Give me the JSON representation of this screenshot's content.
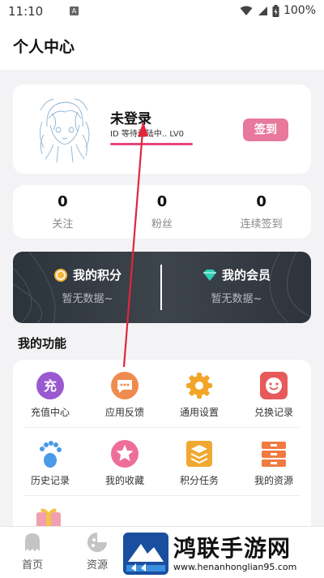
{
  "status_bar": {
    "time": "11:10",
    "notification_icon": "A",
    "battery": "100%"
  },
  "header": {
    "title": "个人中心"
  },
  "profile": {
    "username": "未登录",
    "id_text": "ID 等待登陆中..   LV0",
    "checkin_label": "签到"
  },
  "stats": [
    {
      "value": "0",
      "label": "关注"
    },
    {
      "value": "0",
      "label": "粉丝"
    },
    {
      "value": "0",
      "label": "连续签到"
    }
  ],
  "vip": {
    "points_title": "我的积分",
    "points_sub": "暂无数据~",
    "member_title": "我的会员",
    "member_sub": "暂无数据~"
  },
  "section": {
    "title": "我的功能"
  },
  "functions": [
    {
      "label": "充值中心",
      "icon": "recharge-icon",
      "icon_text": "充",
      "color": "#9b59d0"
    },
    {
      "label": "应用反馈",
      "icon": "feedback-icon",
      "color": "#ef8b4f"
    },
    {
      "label": "通用设置",
      "icon": "settings-icon",
      "color": "#f2a527"
    },
    {
      "label": "兑换记录",
      "icon": "exchange-icon",
      "color": "#e85a5a"
    },
    {
      "label": "历史记录",
      "icon": "history-icon",
      "color": "#4a9ae8"
    },
    {
      "label": "我的收藏",
      "icon": "favorites-icon",
      "color": "#ee6e9a"
    },
    {
      "label": "积分任务",
      "icon": "tasks-icon",
      "color": "#f0a830"
    },
    {
      "label": "我的资源",
      "icon": "resources-icon",
      "color": "#f07a42"
    }
  ],
  "bottom_nav": [
    {
      "label": "首页",
      "icon": "ghost-icon"
    },
    {
      "label": "资源",
      "icon": "gamepad-icon"
    }
  ],
  "watermark": {
    "title": "鸿联手游网",
    "url": "www.henanhonglian95.com"
  }
}
